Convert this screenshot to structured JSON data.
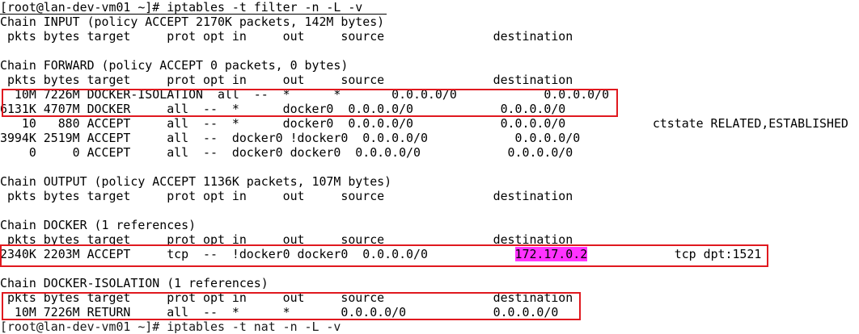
{
  "terminal": {
    "command_line": "[root@lan-dev-vm01 ~]# iptables -t filter -n -L -v",
    "lines": {
      "input_header": "Chain INPUT (policy ACCEPT 2170K packets, 142M bytes)",
      "input_cols": " pkts bytes target     prot opt in     out     source               destination",
      "forward_header": "Chain FORWARD (policy ACCEPT 0 packets, 0 bytes)",
      "forward_cols": " pkts bytes target     prot opt in     out     source               destination",
      "forward_r1": "  10M 7226M DOCKER-ISOLATION  all  --  *      *       0.0.0.0/0            0.0.0.0/0",
      "forward_r2": "6131K 4707M DOCKER     all  --  *      docker0  0.0.0.0/0            0.0.0.0/0",
      "forward_r3": "   10   880 ACCEPT     all  --  *      docker0  0.0.0.0/0            0.0.0.0/0            ctstate RELATED,ESTABLISHED",
      "forward_r4": "3994K 2519M ACCEPT     all  --  docker0 !docker0  0.0.0.0/0            0.0.0.0/0",
      "forward_r5": "    0     0 ACCEPT     all  --  docker0 docker0  0.0.0.0/0            0.0.0.0/0",
      "output_header": "Chain OUTPUT (policy ACCEPT 1136K packets, 107M bytes)",
      "output_cols": " pkts bytes target     prot opt in     out     source               destination",
      "docker_header": "Chain DOCKER (1 references)",
      "docker_cols": " pkts bytes target     prot opt in     out     source               destination",
      "docker_r1_prefix": "2340K 2203M ACCEPT     tcp  --  !docker0 docker0  0.0.0.0/0            ",
      "docker_r1_dest": "172.17.0.2",
      "docker_r1_suffix": "            tcp dpt:1521",
      "isolation_header": "Chain DOCKER-ISOLATION (1 references)",
      "isolation_cols": " pkts bytes target     prot opt in     out     source               destination",
      "isolation_r1": "  10M 7226M RETURN     all  --  *      *       0.0.0.0/0            0.0.0.0/0",
      "partial_next": "[root@lan-dev-vm01 ~]# iptables -t nat -n -L -v"
    }
  },
  "colors": {
    "highlight_box": "#e0191f",
    "selection_magenta": "#ff33ff",
    "background": "#ffffff",
    "text": "#000000"
  }
}
